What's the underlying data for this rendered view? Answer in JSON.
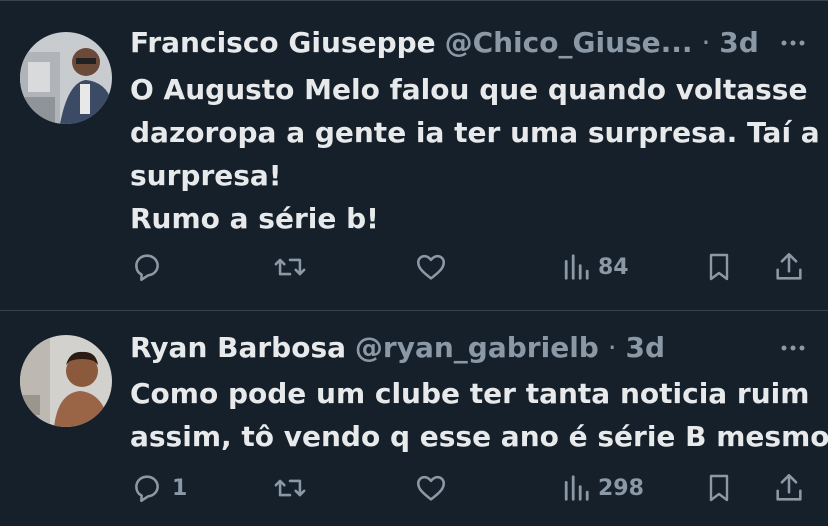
{
  "tweets": [
    {
      "name": "Francisco Giuseppe",
      "handle": "@Chico_Giuse...",
      "separator": "·",
      "time": "3d",
      "lines": [
        "O Augusto Melo falou que quando voltasse",
        "dazoropa a gente ia ter uma surpresa. Taí a",
        "surpresa!",
        "Rumo a série b!"
      ],
      "replies": "",
      "retweets": "",
      "likes": "",
      "views": "84"
    },
    {
      "name": "Ryan Barbosa",
      "handle": "@ryan_gabrielb",
      "separator": "·",
      "time": "3d",
      "lines": [
        "Como pode um clube ter tanta noticia ruim",
        "assim, tô vendo q esse ano é série B mesmo"
      ],
      "replies": "1",
      "retweets": "",
      "likes": "",
      "views": "298"
    }
  ],
  "icons": {
    "reply": "reply-icon",
    "retweet": "retweet-icon",
    "like": "heart-icon",
    "views": "views-icon",
    "bookmark": "bookmark-icon",
    "share": "share-icon",
    "more": "more-icon"
  },
  "colors": {
    "background": "#15202b",
    "text": "#e7e9ea",
    "muted": "#8b98a5",
    "divider": "#38444d"
  }
}
